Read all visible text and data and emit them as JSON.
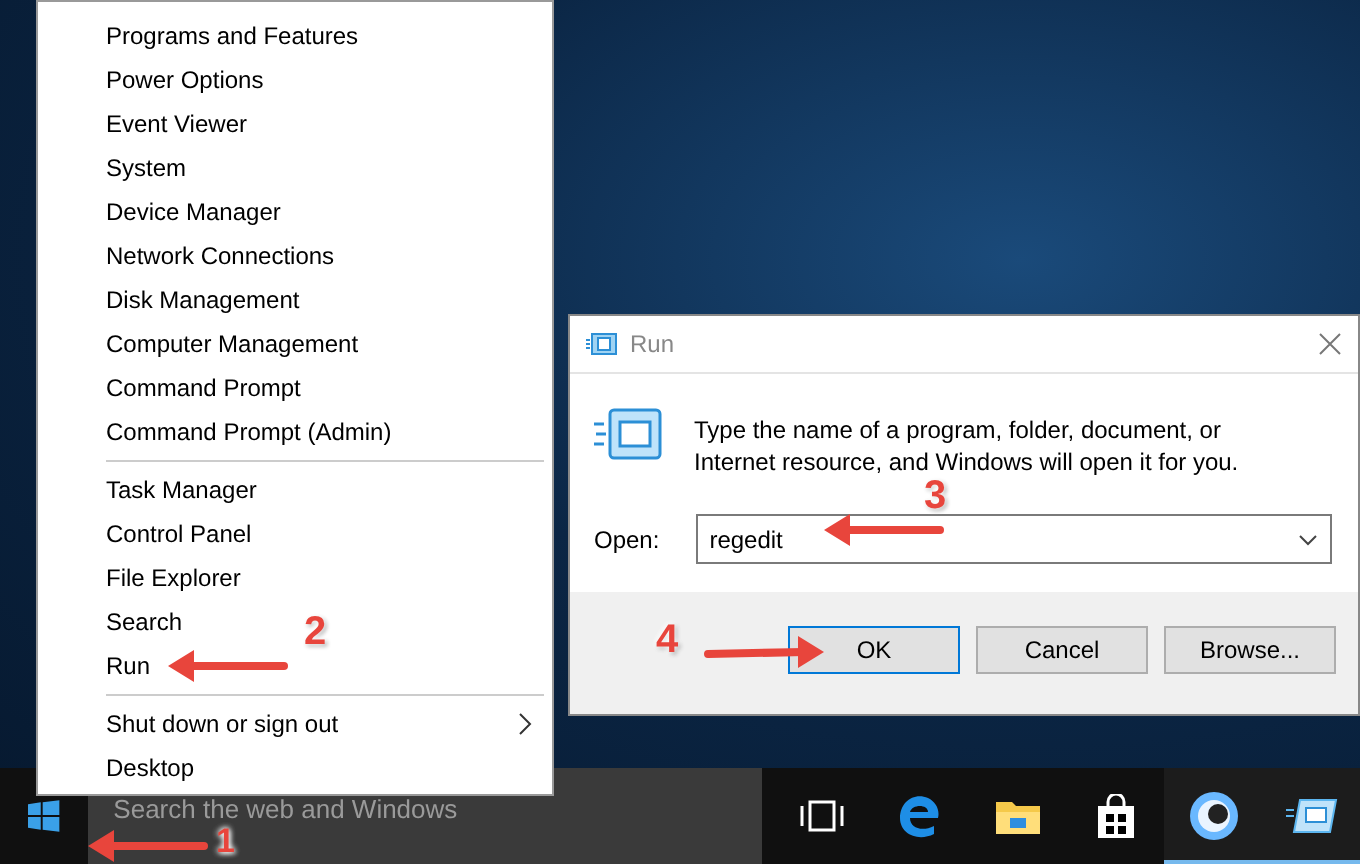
{
  "context_menu": {
    "groups": [
      {
        "items": [
          {
            "label": "Programs and Features",
            "submenu": false
          },
          {
            "label": "Power Options",
            "submenu": false
          },
          {
            "label": "Event Viewer",
            "submenu": false
          },
          {
            "label": "System",
            "submenu": false
          },
          {
            "label": "Device Manager",
            "submenu": false
          },
          {
            "label": "Network Connections",
            "submenu": false
          },
          {
            "label": "Disk Management",
            "submenu": false
          },
          {
            "label": "Computer Management",
            "submenu": false
          },
          {
            "label": "Command Prompt",
            "submenu": false
          },
          {
            "label": "Command Prompt (Admin)",
            "submenu": false
          }
        ]
      },
      {
        "items": [
          {
            "label": "Task Manager",
            "submenu": false
          },
          {
            "label": "Control Panel",
            "submenu": false
          },
          {
            "label": "File Explorer",
            "submenu": false
          },
          {
            "label": "Search",
            "submenu": false
          },
          {
            "label": "Run",
            "submenu": false
          }
        ]
      },
      {
        "items": [
          {
            "label": "Shut down or sign out",
            "submenu": true
          },
          {
            "label": "Desktop",
            "submenu": false
          }
        ]
      }
    ]
  },
  "run_dialog": {
    "title": "Run",
    "description": "Type the name of a program, folder, document, or Internet resource, and Windows will open it for you.",
    "open_label": "Open:",
    "open_value": "regedit",
    "buttons": [
      {
        "label": "OK",
        "default": true
      },
      {
        "label": "Cancel",
        "default": false
      },
      {
        "label": "Browse...",
        "default": false
      }
    ]
  },
  "taskbar": {
    "search_placeholder": "Search the web and Windows",
    "icons": [
      {
        "kind": "task-view",
        "running": false
      },
      {
        "kind": "browser",
        "running": false
      },
      {
        "kind": "folder",
        "running": false
      },
      {
        "kind": "store",
        "running": false
      },
      {
        "kind": "orb",
        "running": true
      },
      {
        "kind": "run",
        "running": true
      }
    ]
  },
  "annotations": [
    {
      "number": "1"
    },
    {
      "number": "2"
    },
    {
      "number": "3"
    },
    {
      "number": "4"
    }
  ]
}
